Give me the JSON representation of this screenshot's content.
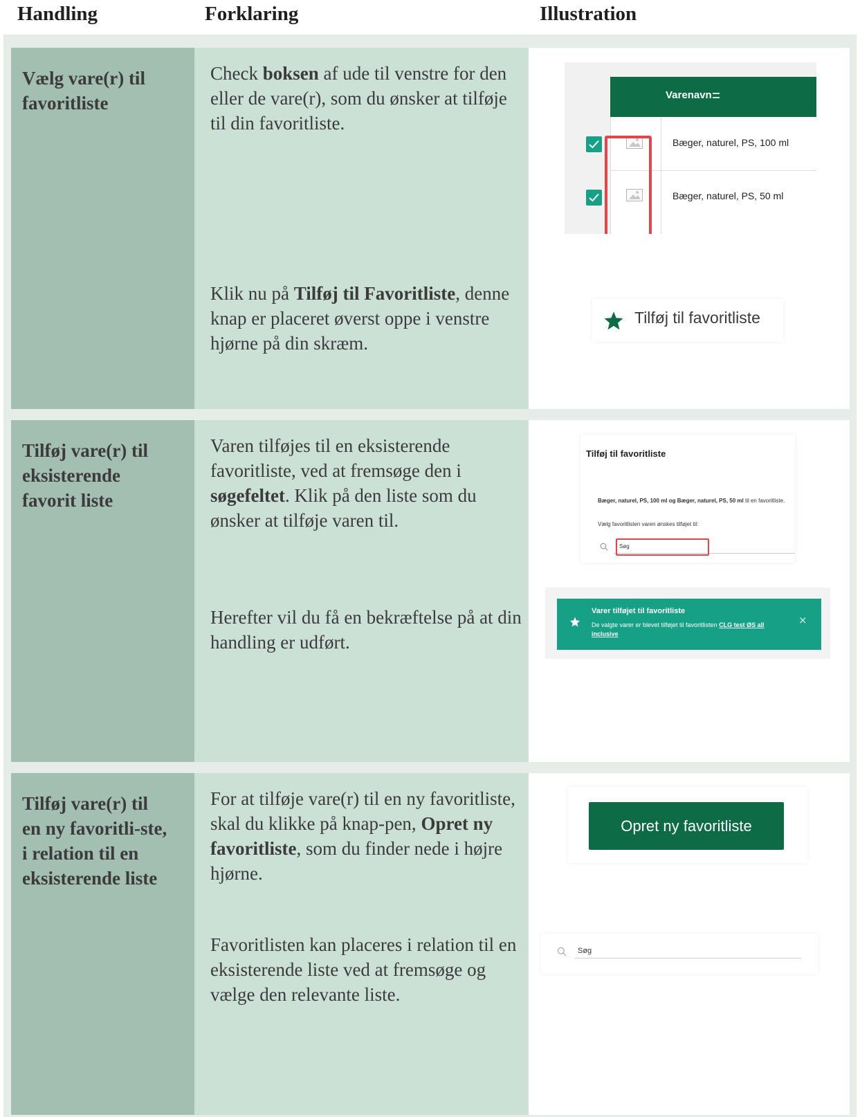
{
  "headers": {
    "handling": "Handling",
    "forklaring": "Forklaring",
    "illustration": "Illustration"
  },
  "rows": [
    {
      "handling": "Vælg vare(r) til favoritliste",
      "p1": {
        "a": "Check ",
        "b": "boksen",
        "c": " af ude til venstre for den eller de vare(r), som du ønsker at tilføje til din favoritliste."
      },
      "p2": {
        "a": "Klik nu på ",
        "b": "Tilføj til Favoritliste",
        "c": ", denne knap er placeret øverst oppe i venstre hjørne på din skræm."
      },
      "illus": {
        "column_header": "Varenavn",
        "products": [
          "Bæger, naturel, PS, 100 ml",
          "Bæger, naturel, PS, 50 ml"
        ],
        "fav_button": "Tilføj til favoritliste"
      }
    },
    {
      "handling": "Tilføj vare(r) til eksisterende favorit liste",
      "p1": {
        "a": "Varen tilføjes til en eksisterende favoritliste, ved at fremsøge den i ",
        "b": "søgefeltet",
        "c": ". Klik på den liste som du ønsker at tilføje varen til."
      },
      "p2": {
        "text": "Herefter vil du få en bekræftelse på at din handling er udført."
      },
      "illus": {
        "dialog_title": "Tilføj til favoritliste",
        "dialog_bold": "Bæger, naturel, PS, 100 ml og Bæger, naturel, PS, 50 ml",
        "dialog_rest": " til en favoritliste.",
        "dialog_choose": "Vælg favoritlisten varen ønskes tilføjet til:",
        "search_placeholder": "Søg",
        "toast_title": "Varer tilføjet til favoritliste",
        "toast_text": "De valgte varer er blevet tilføjet til favoritlisten ",
        "toast_link": "CLG test ØS all inclusive",
        "toast_close": "×"
      }
    },
    {
      "handling": "Tilføj vare(r) til en ny favoritli-ste, i relation til en eksisterende liste",
      "p1": {
        "a": "For at tilføje vare(r) til en ny favoritliste, skal du klikke på knap-pen, ",
        "b": "Opret ny favoritliste",
        "c": ", som du finder nede i højre hjørne."
      },
      "p2": {
        "text": "Favoritlisten kan placeres i relation til en eksisterende liste ved at fremsøge og vælge den relevante liste."
      },
      "illus": {
        "new_button": "Opret ny favoritliste",
        "search_placeholder": "Søg"
      }
    }
  ],
  "colors": {
    "green_dark": "#0d6b45",
    "teal": "#16a085",
    "col1": "#a3bfb1",
    "col2": "#cce1d5",
    "red": "#e0464c"
  }
}
